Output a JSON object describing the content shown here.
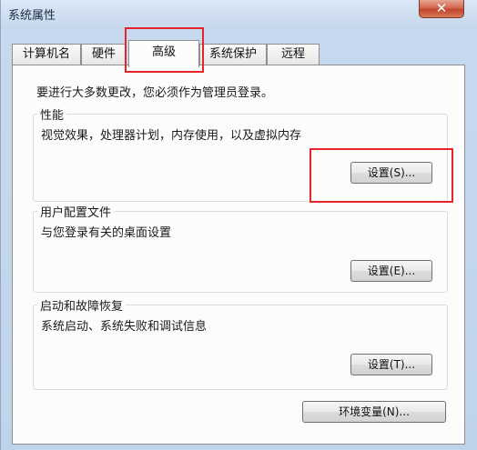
{
  "window": {
    "title": "系统属性",
    "close_glyph": "✕"
  },
  "tabs": [
    {
      "label": "计算机名"
    },
    {
      "label": "硬件"
    },
    {
      "label": "高级"
    },
    {
      "label": "系统保护"
    },
    {
      "label": "远程"
    }
  ],
  "intro": "要进行大多数更改，您必须作为管理员登录。",
  "performance": {
    "legend": "性能",
    "description": "视觉效果，处理器计划，内存使用，以及虚拟内存",
    "button": "设置(S)..."
  },
  "user_profiles": {
    "legend": "用户配置文件",
    "description": "与您登录有关的桌面设置",
    "button": "设置(E)..."
  },
  "startup_recovery": {
    "legend": "启动和故障恢复",
    "description": "系统启动、系统失败和调试信息",
    "button": "设置(T)..."
  },
  "env_button": "环境变量(N)...",
  "colors": {
    "highlight": "#e8242b",
    "close": "#c0452c"
  }
}
